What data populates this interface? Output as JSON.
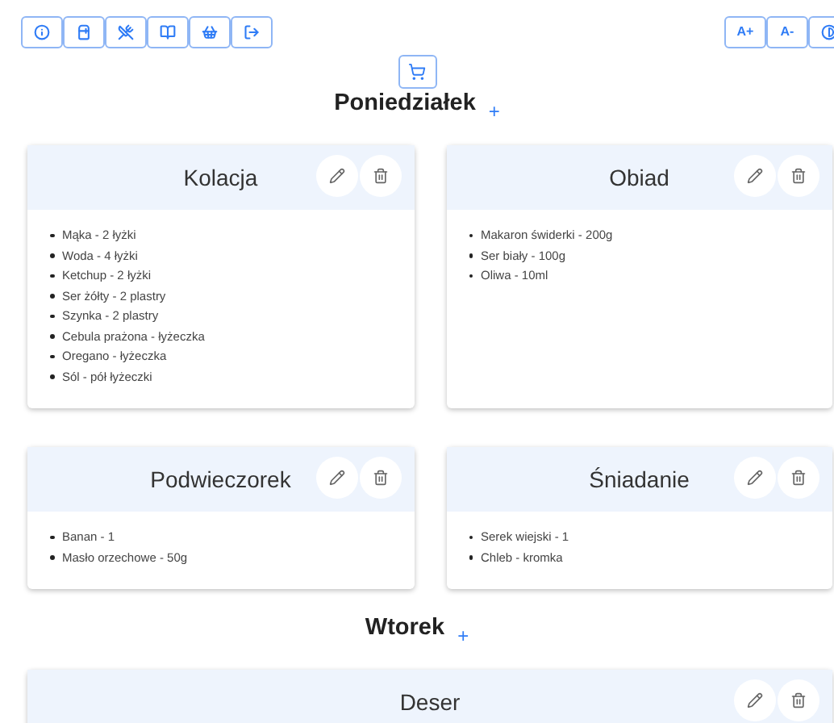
{
  "toolbar_left": [
    {
      "kind": "info"
    },
    {
      "kind": "fridge"
    },
    {
      "kind": "utensils"
    },
    {
      "kind": "book"
    },
    {
      "kind": "basket"
    },
    {
      "kind": "logout"
    }
  ],
  "toolbar_right": [
    {
      "kind": "text",
      "label": "A+"
    },
    {
      "kind": "text",
      "label": "A-"
    },
    {
      "kind": "contrast"
    }
  ],
  "days": [
    {
      "name": "Poniedziałek",
      "add": "+",
      "meals": [
        {
          "title": "Kolacja",
          "ingredients": [
            "Mąka - 2 łyżki",
            "Woda - 4 łyżki",
            "Ketchup - 2 łyżki",
            "Ser żółty - 2 plastry",
            "Szynka - 2 plastry",
            "Cebula prażona - łyżeczka",
            "Oregano - łyżeczka",
            "Sól - pół łyżeczki"
          ]
        },
        {
          "title": "Obiad",
          "ingredients": [
            "Makaron świderki - 200g",
            "Ser biały - 100g",
            "Oliwa - 10ml"
          ]
        },
        {
          "title": "Podwieczorek",
          "ingredients": [
            "Banan - 1",
            "Masło orzechowe - 50g"
          ]
        },
        {
          "title": "Śniadanie",
          "ingredients": [
            "Serek wiejski - 1",
            "Chleb - kromka"
          ]
        }
      ]
    },
    {
      "name": "Wtorek",
      "add": "+",
      "meals": [
        {
          "title": "Deser"
        }
      ]
    }
  ]
}
